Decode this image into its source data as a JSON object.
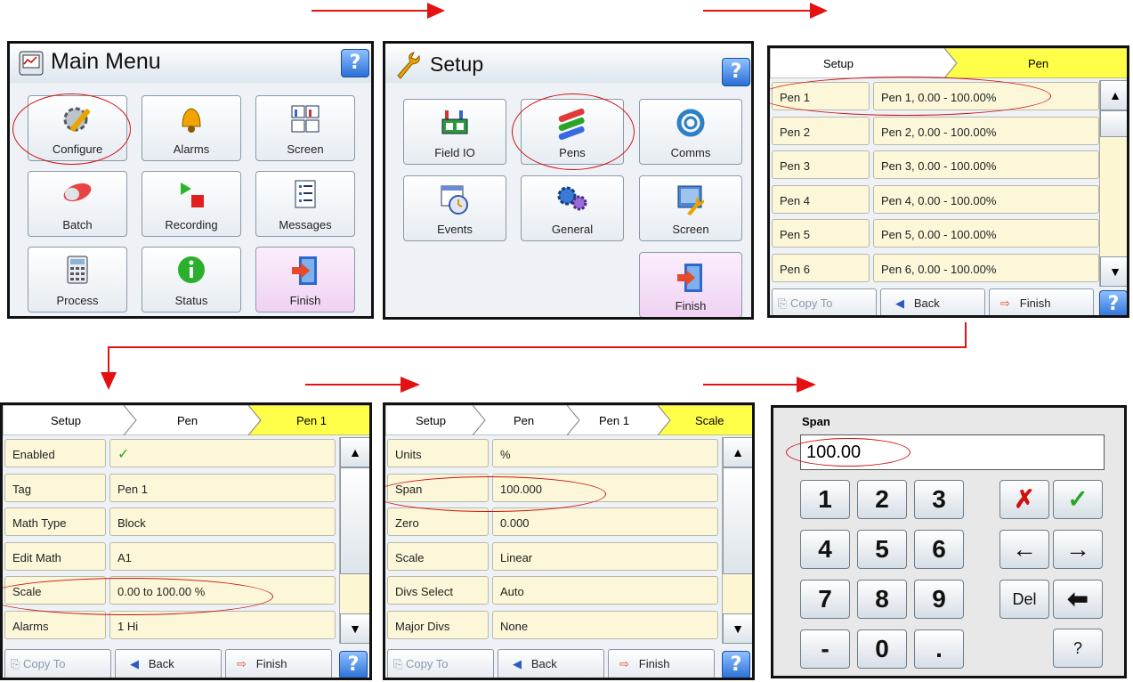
{
  "main_menu": {
    "title": "Main Menu",
    "help": "?",
    "tiles": [
      {
        "label": "Configure",
        "icon": "configure-icon"
      },
      {
        "label": "Alarms",
        "icon": "bell-icon"
      },
      {
        "label": "Screen",
        "icon": "screen-icon"
      },
      {
        "label": "Batch",
        "icon": "batch-icon"
      },
      {
        "label": "Recording",
        "icon": "recording-icon"
      },
      {
        "label": "Messages",
        "icon": "messages-icon"
      },
      {
        "label": "Process",
        "icon": "calculator-icon"
      },
      {
        "label": "Status",
        "icon": "info-icon"
      },
      {
        "label": "Finish",
        "icon": "exit-door-icon"
      }
    ]
  },
  "setup": {
    "title": "Setup",
    "help": "?",
    "tiles": [
      {
        "label": "Field IO",
        "icon": "field-io-icon"
      },
      {
        "label": "Pens",
        "icon": "pens-icon"
      },
      {
        "label": "Comms",
        "icon": "comms-icon"
      },
      {
        "label": "Events",
        "icon": "events-icon"
      },
      {
        "label": "General",
        "icon": "gears-icon"
      },
      {
        "label": "Screen",
        "icon": "screen-setup-icon"
      },
      {
        "label": "Finish",
        "icon": "exit-door-icon"
      }
    ]
  },
  "pen_list": {
    "breadcrumb": [
      "Setup",
      "Pen"
    ],
    "rows": [
      {
        "name": "Pen 1",
        "value": "Pen 1, 0.00 - 100.00%"
      },
      {
        "name": "Pen 2",
        "value": "Pen 2, 0.00 - 100.00%"
      },
      {
        "name": "Pen 3",
        "value": "Pen 3, 0.00 - 100.00%"
      },
      {
        "name": "Pen 4",
        "value": "Pen 4, 0.00 - 100.00%"
      },
      {
        "name": "Pen 5",
        "value": "Pen 5, 0.00 - 100.00%"
      },
      {
        "name": "Pen 6",
        "value": "Pen 6, 0.00 - 100.00%"
      }
    ],
    "footer": {
      "copy": "Copy To",
      "back": "Back",
      "finish": "Finish",
      "help": "?"
    }
  },
  "pen1": {
    "breadcrumb": [
      "Setup",
      "Pen",
      "Pen 1"
    ],
    "rows": [
      {
        "name": "Enabled",
        "value": "✓"
      },
      {
        "name": "Tag",
        "value": "Pen 1"
      },
      {
        "name": "Math Type",
        "value": "Block"
      },
      {
        "name": "Edit Math",
        "value": "A1"
      },
      {
        "name": "Scale",
        "value": "0.00 to 100.00 %"
      },
      {
        "name": "Alarms",
        "value": "1 Hi"
      }
    ],
    "footer": {
      "copy": "Copy To",
      "back": "Back",
      "finish": "Finish",
      "help": "?"
    }
  },
  "scale": {
    "breadcrumb": [
      "Setup",
      "Pen",
      "Pen 1",
      "Scale"
    ],
    "rows": [
      {
        "name": "Units",
        "value": "%"
      },
      {
        "name": "Span",
        "value": "100.000"
      },
      {
        "name": "Zero",
        "value": "0.000"
      },
      {
        "name": "Scale",
        "value": "Linear"
      },
      {
        "name": "Divs Select",
        "value": "Auto"
      },
      {
        "name": "Major Divs",
        "value": "None"
      }
    ],
    "footer": {
      "copy": "Copy To",
      "back": "Back",
      "finish": "Finish",
      "help": "?"
    }
  },
  "keypad": {
    "label": "Span",
    "value": "100.00",
    "keys": [
      "1",
      "2",
      "3",
      "4",
      "5",
      "6",
      "7",
      "8",
      "9",
      "-",
      "0",
      "."
    ],
    "side": {
      "cancel": "✗",
      "ok": "✓",
      "left": "←",
      "right": "→",
      "del": "Del",
      "backspace": "⬅",
      "help": "?"
    }
  },
  "colors": {
    "highlight": "#d01010",
    "breadcrumb_active": "#ffff44",
    "row_bg": "#fbf7d8"
  }
}
